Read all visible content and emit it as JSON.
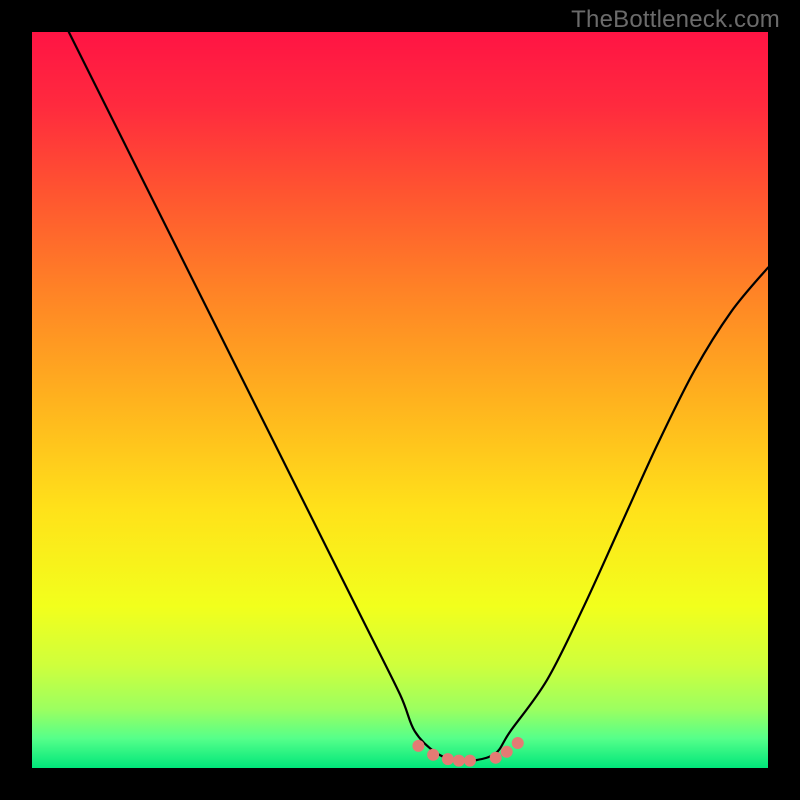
{
  "watermark": "TheBottleneck.com",
  "gradient_stops": [
    {
      "offset": 0.0,
      "color": "#ff1444"
    },
    {
      "offset": 0.1,
      "color": "#ff2a3e"
    },
    {
      "offset": 0.22,
      "color": "#ff5530"
    },
    {
      "offset": 0.35,
      "color": "#ff8226"
    },
    {
      "offset": 0.5,
      "color": "#ffb21e"
    },
    {
      "offset": 0.65,
      "color": "#ffe21a"
    },
    {
      "offset": 0.78,
      "color": "#f2ff1c"
    },
    {
      "offset": 0.86,
      "color": "#cfff3c"
    },
    {
      "offset": 0.92,
      "color": "#9cff60"
    },
    {
      "offset": 0.96,
      "color": "#55ff8a"
    },
    {
      "offset": 1.0,
      "color": "#00e67a"
    }
  ],
  "chart_data": {
    "type": "line",
    "title": "",
    "xlabel": "",
    "ylabel": "",
    "xlim": [
      0,
      100
    ],
    "ylim": [
      0,
      100
    ],
    "grid": false,
    "series": [
      {
        "name": "bottleneck-curve",
        "x": [
          5,
          10,
          15,
          20,
          25,
          30,
          35,
          40,
          45,
          50,
          52,
          55,
          58,
          60,
          63,
          65,
          70,
          75,
          80,
          85,
          90,
          95,
          100
        ],
        "y": [
          100,
          90,
          80,
          70,
          60,
          50,
          40,
          30,
          20,
          10,
          5,
          2,
          1,
          1,
          2,
          5,
          12,
          22,
          33,
          44,
          54,
          62,
          68
        ]
      }
    ],
    "markers": {
      "name": "bottom-dots",
      "x": [
        52.5,
        54.5,
        56.5,
        58.0,
        59.5,
        63.0,
        64.5,
        66.0
      ],
      "y": [
        3.0,
        1.8,
        1.2,
        1.0,
        1.0,
        1.4,
        2.2,
        3.4
      ],
      "color": "#e47b74",
      "radius": 6
    }
  }
}
